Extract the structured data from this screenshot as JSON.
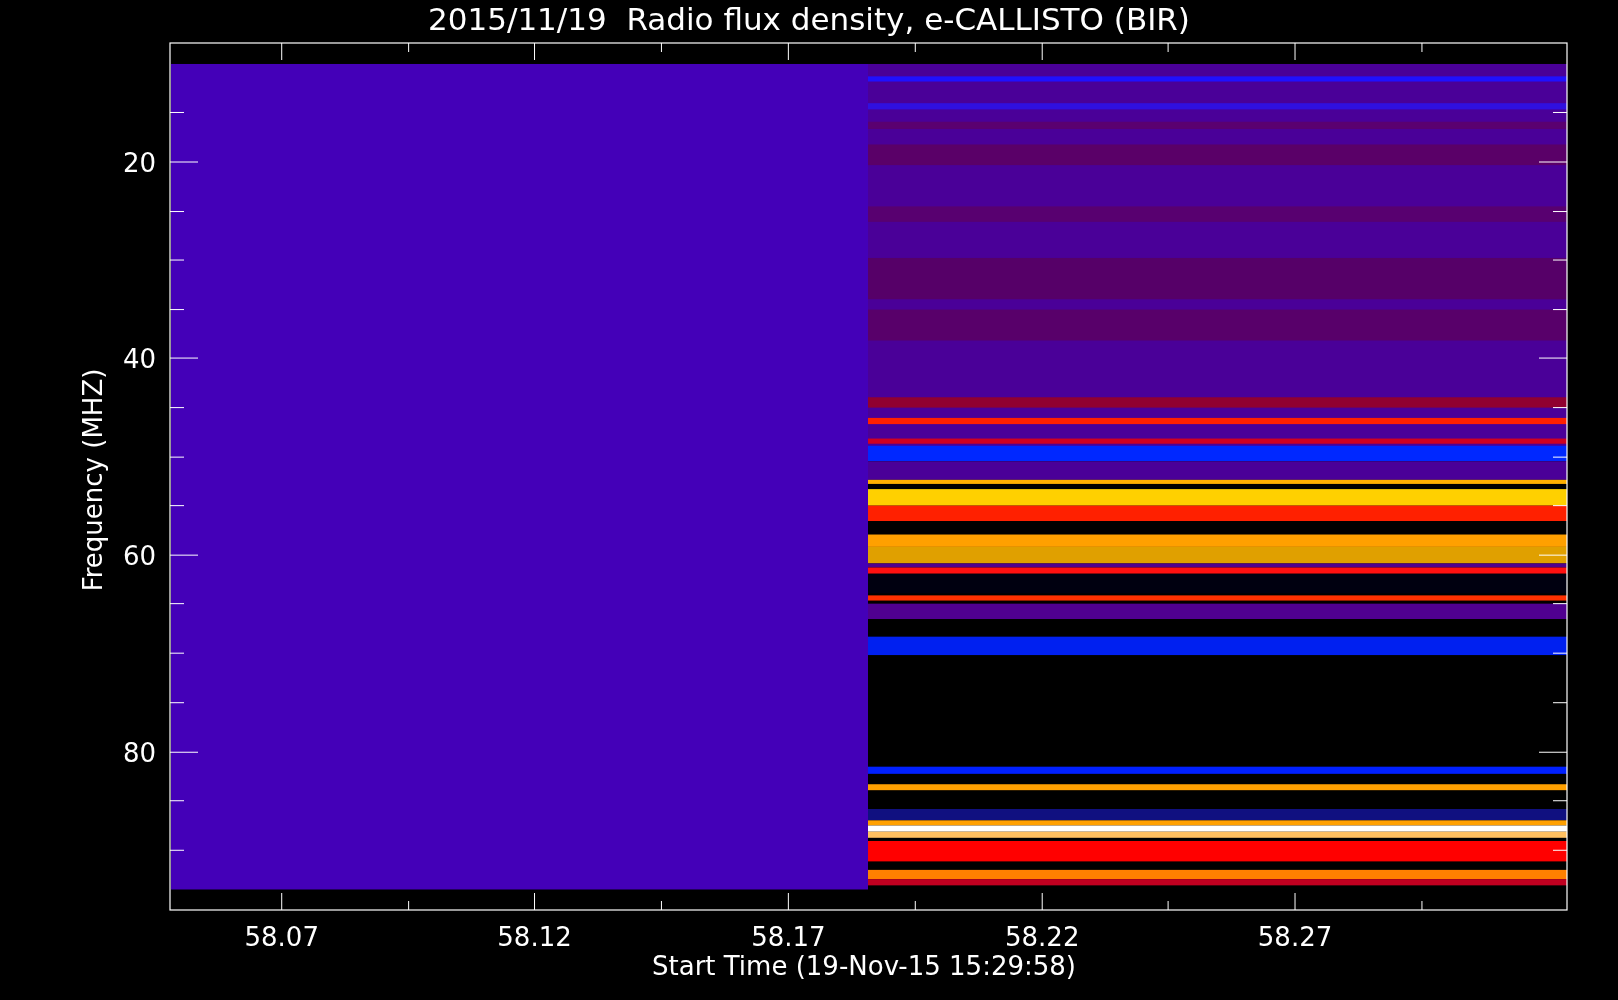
{
  "title": "2015/11/19  Radio flux density, e-CALLISTO (BIR)",
  "y_axis": {
    "label": "Frequency (MHZ)",
    "ticks": [
      "20",
      "40",
      "60",
      "80"
    ]
  },
  "x_axis": {
    "label": "Start Time (19-Nov-15 15:29:58)",
    "ticks": [
      "58.07",
      "58.12",
      "58.17",
      "58.22",
      "58.27"
    ]
  }
}
